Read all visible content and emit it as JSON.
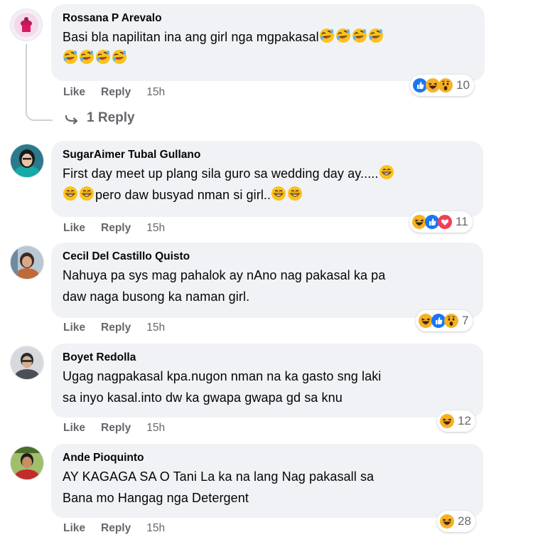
{
  "comments": [
    {
      "author": "Rossana P Arevalo",
      "text_line1": "Basi bla napilitan ina ang girl nga mgpakasal",
      "like": "Like",
      "reply": "Reply",
      "time": "15h",
      "reaction_count": "10",
      "reactions": [
        "like-icon",
        "haha-icon",
        "wow-icon"
      ],
      "replies_label": "1 Reply"
    },
    {
      "author": "SugarAimer Tubal Gullano",
      "text_line1": "First day meet up plang sila guro sa wedding day ay.....",
      "text_line2": "pero daw busyad nman si girl..",
      "like": "Like",
      "reply": "Reply",
      "time": "15h",
      "reaction_count": "11",
      "reactions": [
        "haha-icon",
        "like-icon",
        "love-icon"
      ]
    },
    {
      "author": "Cecil Del Castillo Quisto",
      "text_line1": "Nahuya pa sys mag pahalok ay nAno nag pakasal ka pa",
      "text_line2": "daw naga busong ka naman girl.",
      "like": "Like",
      "reply": "Reply",
      "time": "15h",
      "reaction_count": "7",
      "reactions": [
        "haha-icon",
        "like-icon",
        "wow-icon"
      ]
    },
    {
      "author": "Boyet Redolla",
      "text_line1": "Ugag nagpakasal kpa.nugon nman na ka gasto sng laki",
      "text_line2": "sa inyo kasal.into dw ka gwapa gwapa gd sa knu",
      "like": "Like",
      "reply": "Reply",
      "time": "15h",
      "reaction_count": "12",
      "reactions": [
        "haha-icon"
      ]
    },
    {
      "author": "Ande Pioquinto",
      "text_line1": "AY KAGAGA SA O Tani La ka na lang Nag pakasall sa",
      "text_line2": "Bana mo Hangag nga Detergent",
      "like": "Like",
      "reply": "Reply",
      "time": "15h",
      "reaction_count": "28",
      "reactions": [
        "haha-icon"
      ]
    }
  ],
  "colors": {
    "bubble": "#f0f2f5",
    "secondary_text": "#65676b",
    "like_blue": "#1877f2",
    "haha_yellow": "#f7b125",
    "love_red": "#f33e58"
  }
}
